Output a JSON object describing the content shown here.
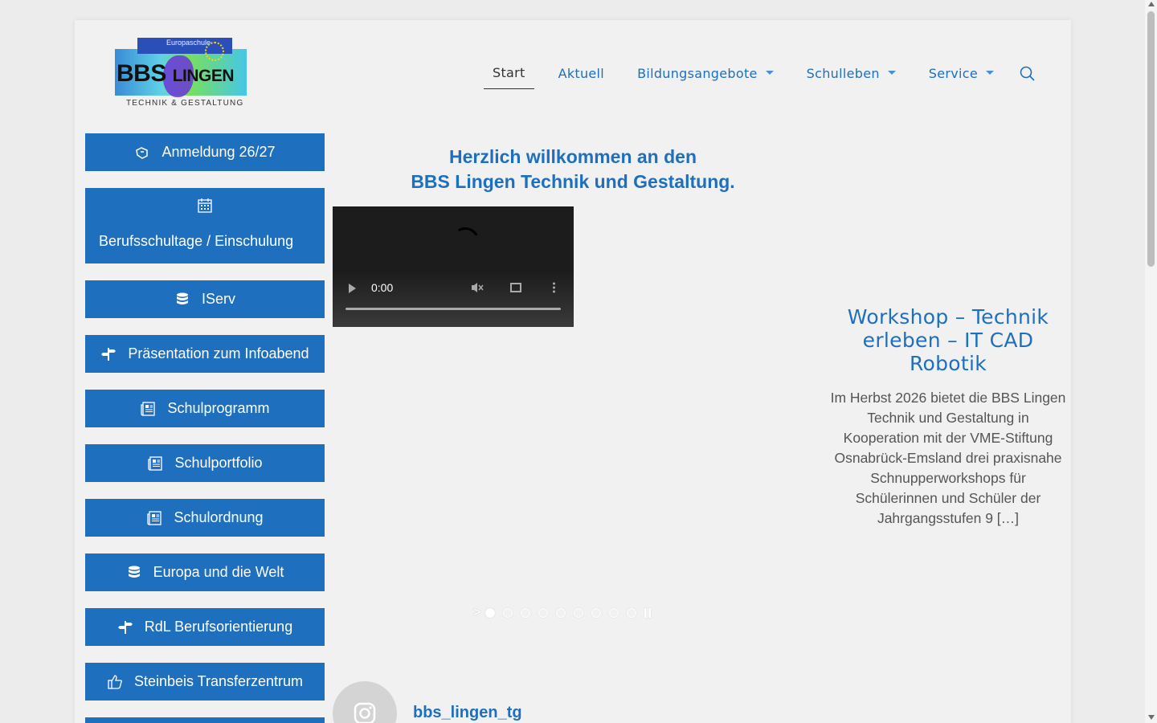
{
  "logo": {
    "line1": "BBS",
    "line2": "LINGEN",
    "tagline": "TECHNIK & GESTALTUNG",
    "badge": "Europaschule"
  },
  "nav": {
    "items": [
      {
        "label": "Start",
        "active": true,
        "dropdown": false
      },
      {
        "label": "Aktuell",
        "active": false,
        "dropdown": false
      },
      {
        "label": "Bildungsangebote",
        "active": false,
        "dropdown": true
      },
      {
        "label": "Schulleben",
        "active": false,
        "dropdown": true
      },
      {
        "label": "Service",
        "active": false,
        "dropdown": true
      }
    ],
    "search_icon": "search-icon"
  },
  "sidebar": {
    "buttons": [
      {
        "label": "Anmeldung 26/27",
        "icon": "hand-paper-icon"
      },
      {
        "label": "Berufsschultage / Einschulung",
        "icon": "calendar-icon"
      },
      {
        "label": "IServ",
        "icon": "database-icon"
      },
      {
        "label": "Präsentation zum Infoabend",
        "icon": "signpost-icon"
      },
      {
        "label": "Schulprogramm",
        "icon": "newspaper-icon"
      },
      {
        "label": "Schulportfolio",
        "icon": "newspaper-icon"
      },
      {
        "label": "Schulordnung",
        "icon": "newspaper-icon"
      },
      {
        "label": "Europa und die Welt",
        "icon": "database-icon"
      },
      {
        "label": "RdL Berufsorientierung",
        "icon": "signpost-icon"
      },
      {
        "label": "Steinbeis Transferzentrum",
        "icon": "thumbs-up-icon"
      }
    ]
  },
  "welcome": {
    "line1": "Herzlich willkommen an den",
    "line2": "BBS Lingen Technik und Gestaltung."
  },
  "video": {
    "time": "0:00"
  },
  "article": {
    "title": "Workshop – Technik erleben – IT CAD Robotik",
    "excerpt": "Im Herbst 2026 bietet die BBS Lingen Technik und Gestaltung in Kooperation mit der VME-Stiftung Osnabrück-Emsland drei praxisnahe Schnupperworkshops für Schülerinnen und Schüler der Jahrgangsstufen 9 […]"
  },
  "slider": {
    "slide_count": 9,
    "active_slide": 1
  },
  "instagram": {
    "username": "bbs_lingen_tg",
    "icon": "instagram-icon"
  },
  "colors": {
    "primary": "#1f6fbf",
    "page_bg": "#f1f1f1",
    "outer_bg": "#ececec"
  }
}
